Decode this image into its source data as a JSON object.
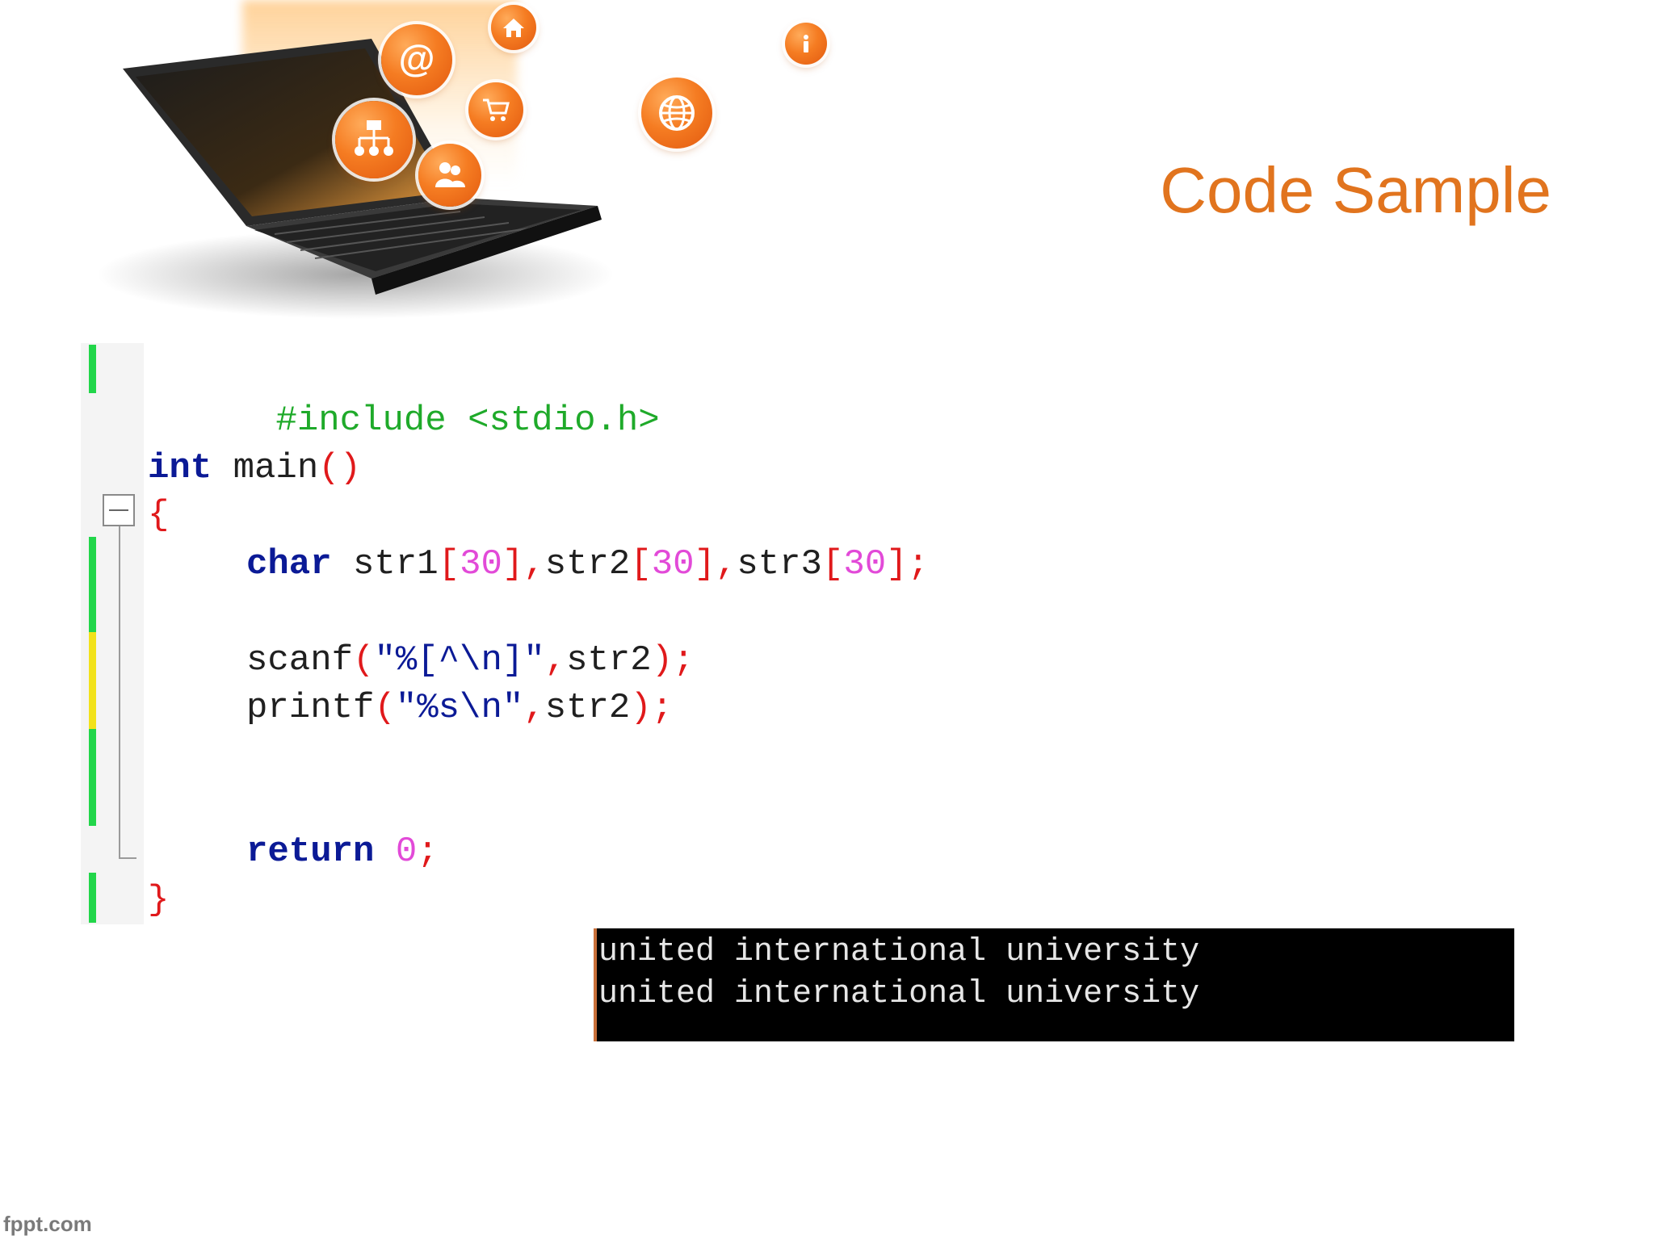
{
  "slide": {
    "title": "Code Sample",
    "watermark": "fppt.com"
  },
  "hero_icons": [
    "at-sign-icon",
    "home-icon",
    "shopping-cart-icon",
    "sitemap-icon",
    "users-icon",
    "globe-icon",
    "info-icon"
  ],
  "code": {
    "line1": {
      "directive": "#include <stdio.h>"
    },
    "line2": {
      "type": "int",
      "name": " main",
      "parens": "()"
    },
    "line3": {
      "brace": "{"
    },
    "line4": {
      "type": "char",
      "v1": " str1",
      "o1": "[",
      "n1": "30",
      "c1": "],",
      "v2": "str2",
      "o2": "[",
      "n2": "30",
      "c2": "],",
      "v3": "str3",
      "o3": "[",
      "n3": "30",
      "c3": "];"
    },
    "line5": {
      "fn": "scanf",
      "open": "(",
      "str": "\"%[^\\n]\"",
      "sep": ",",
      "arg": "str2",
      "close": ");"
    },
    "line6": {
      "fn": "printf",
      "open": "(",
      "str": "\"%s\\n\"",
      "sep": ",",
      "arg": "str2",
      "close": ");"
    },
    "line7": {
      "kw": "return",
      "value": " 0",
      "end": ";"
    },
    "line8": {
      "brace": "}"
    }
  },
  "console": {
    "lines": [
      "united international university",
      "united international university"
    ]
  },
  "colors": {
    "title": "#e1741e",
    "bubble": "#f57c22",
    "change_saved": "#22d64a",
    "change_unsaved": "#f2e21a",
    "console_bg": "#000000"
  }
}
